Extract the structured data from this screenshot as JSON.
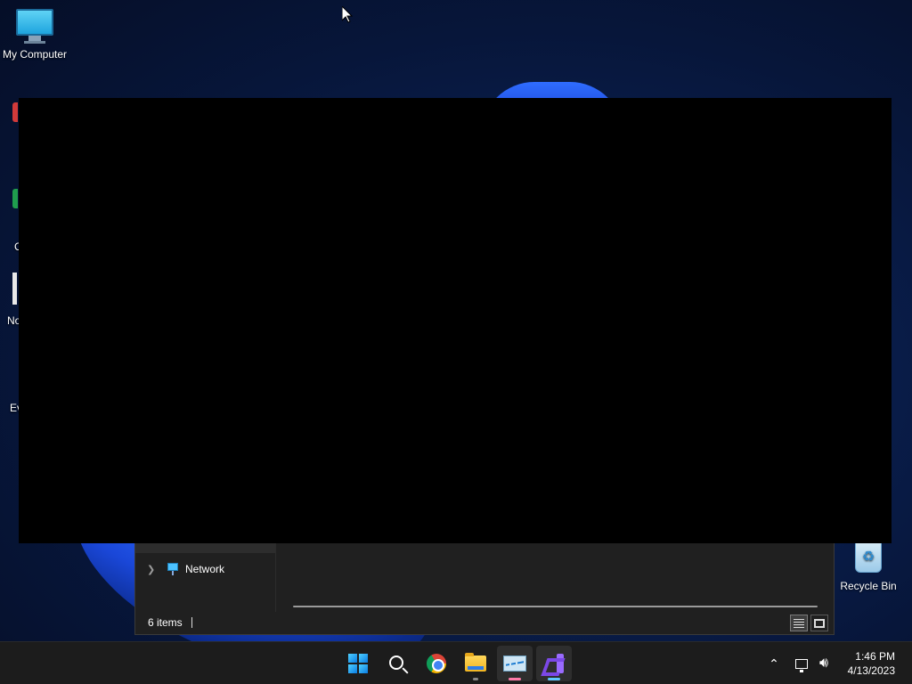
{
  "desktop": {
    "icons": {
      "my_computer": "My Computer",
      "recycle_bin": "Recycle Bin"
    },
    "partial_labels": [
      "C",
      "No",
      "Ev"
    ]
  },
  "explorer": {
    "nav": {
      "network_label": "Network"
    },
    "status": {
      "item_count": "6 items"
    }
  },
  "taskbar": {
    "apps": [
      {
        "name": "Start",
        "icon": "windows-icon"
      },
      {
        "name": "Search",
        "icon": "search-icon"
      },
      {
        "name": "Google Chrome",
        "icon": "chrome-icon"
      },
      {
        "name": "File Explorer",
        "icon": "folder-icon"
      },
      {
        "name": "Performance Monitor",
        "icon": "performance-monitor-icon"
      },
      {
        "name": "Visual Studio",
        "icon": "visual-studio-icon"
      }
    ],
    "clock": {
      "time": "1:46 PM",
      "date": "4/13/2023"
    }
  },
  "colors": {
    "taskbar": "#1c1c1c",
    "accent": "#5ec8ff",
    "window_bg": "#202020"
  }
}
